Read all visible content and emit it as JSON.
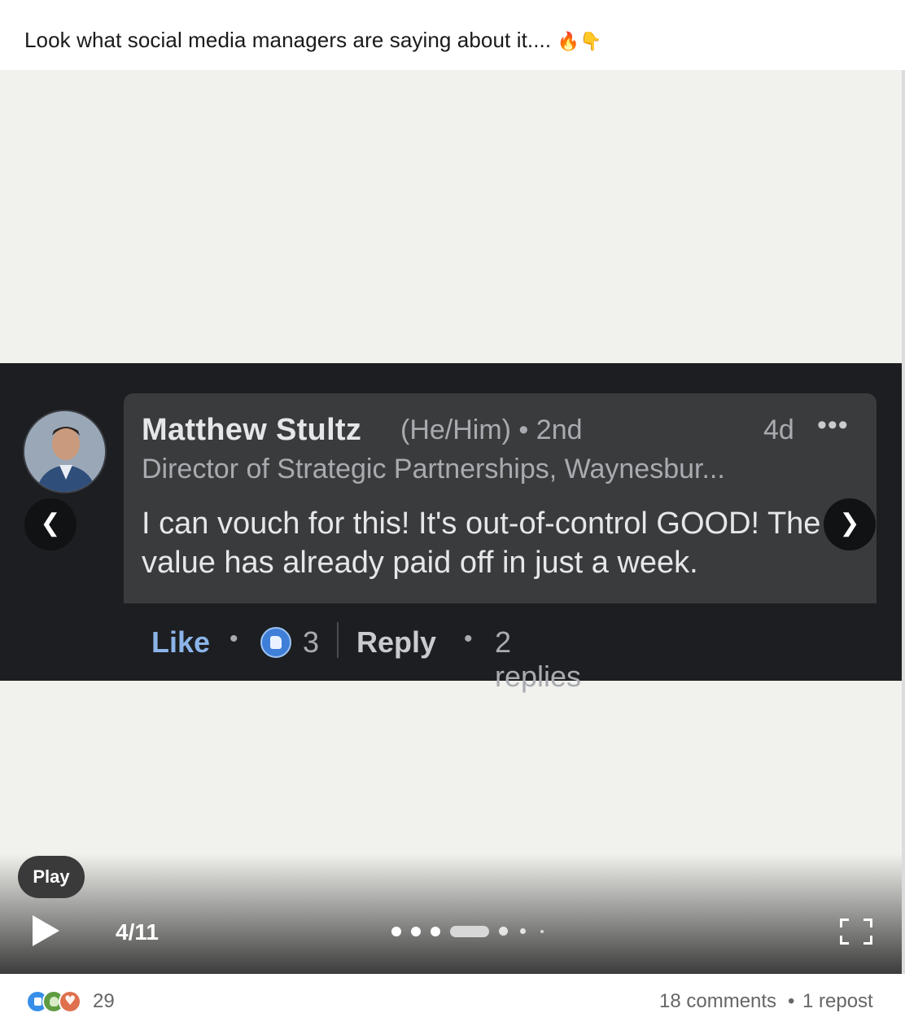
{
  "post": {
    "caption": "Look what social media managers are saying about it....",
    "caption_emoji": "🔥👇"
  },
  "slide": {
    "comment": {
      "author_name": "Matthew Stultz",
      "pronouns_degree": "(He/Him) • 2nd",
      "time": "4d",
      "more_label": "•••",
      "headline": "Director of Strategic Partnerships, Waynesbur...",
      "body": "I can vouch for this! It's out-of-control GOOD! The value has already paid off in just a week.",
      "like_label": "Like",
      "separator": "•",
      "like_count": "3",
      "reply_label": "Reply",
      "replies_label": "2 replies"
    }
  },
  "carousel": {
    "prev_label": "❮",
    "next_label": "❯",
    "play_tooltip": "Play",
    "page_counter": "4/11",
    "current_page": 4,
    "total_pages": 11
  },
  "social": {
    "reaction_count": "29",
    "comments": "18 comments",
    "separator": "•",
    "reposts": "1 repost",
    "reaction_icons": [
      "like-icon",
      "support-icon",
      "love-icon"
    ]
  },
  "colors": {
    "accent_blue": "#378fe9",
    "slide_bg": "#1c1e21",
    "bubble_bg": "#3a3b3d",
    "media_bg": "#f1f1ed"
  }
}
